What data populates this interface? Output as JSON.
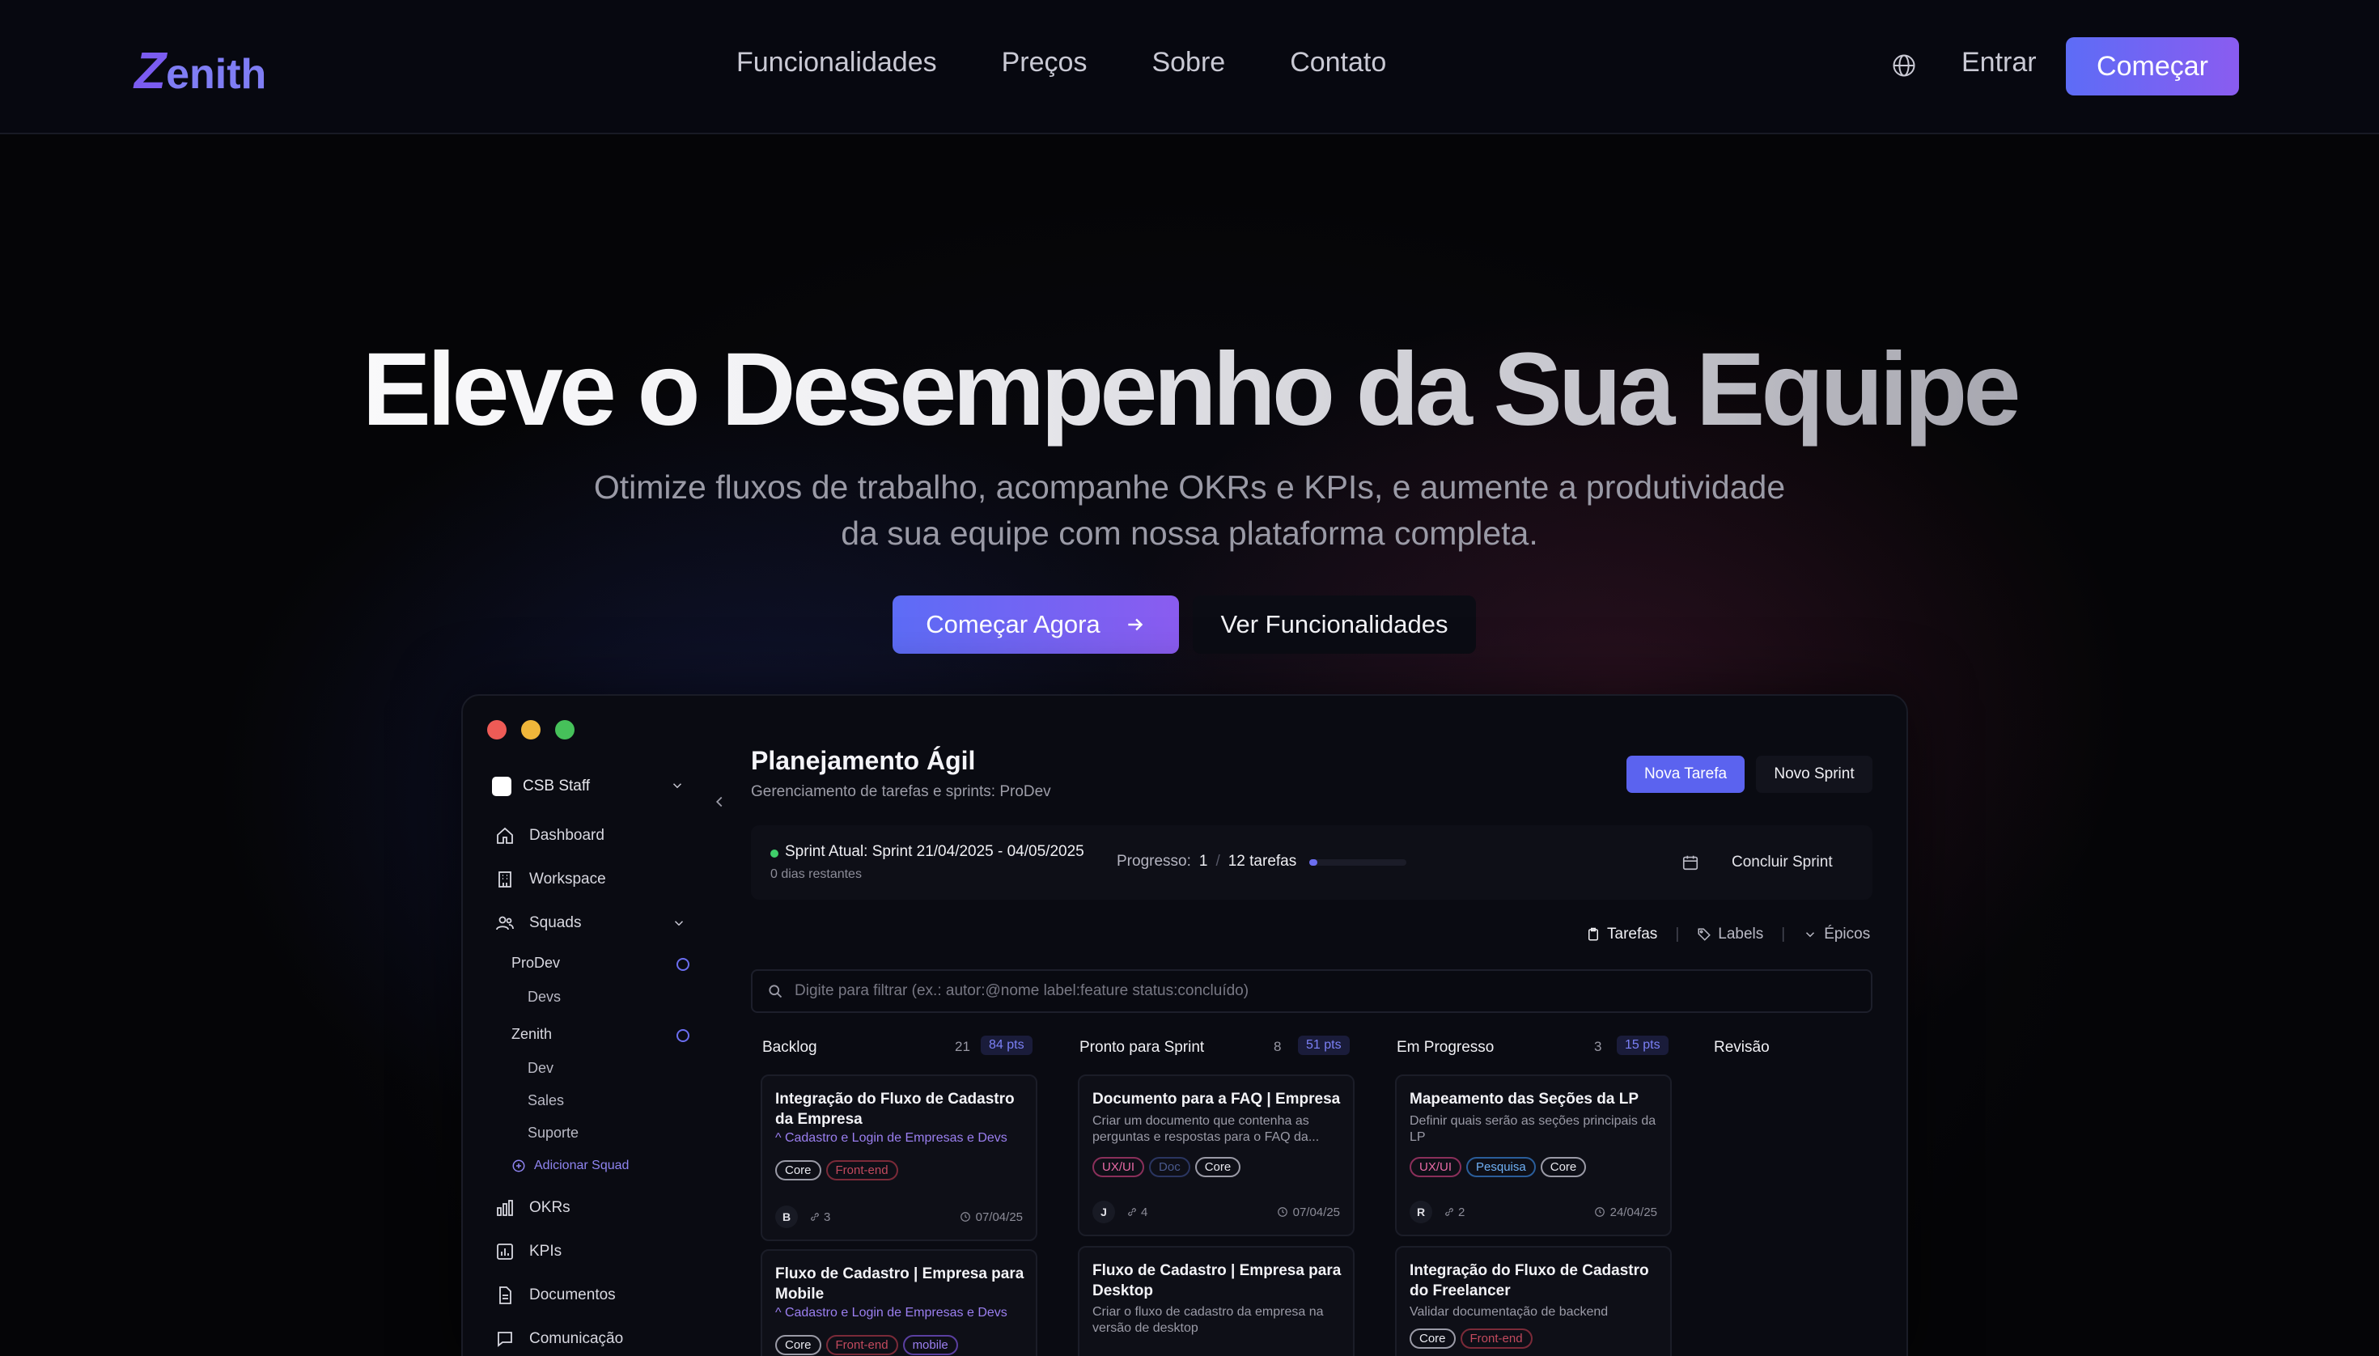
{
  "nav": {
    "logo_z": "Z",
    "logo_rest": "enith",
    "links": [
      "Funcionalidades",
      "Preços",
      "Sobre",
      "Contato"
    ],
    "login": "Entrar",
    "cta": "Começar"
  },
  "hero": {
    "title": "Eleve o Desempenho da Sua Equipe",
    "subtitle": "Otimize fluxos de trabalho, acompanhe OKRs e KPIs, e aumente a produtividade da sua equipe com nossa plataforma completa.",
    "cta_primary": "Começar Agora",
    "cta_secondary": "Ver Funcionalidades"
  },
  "colors": {
    "accent": "#5d6cf6",
    "accent2": "#8a5cf0",
    "bg": "#050507",
    "traffic_red": "#ee5b56",
    "traffic_yellow": "#f0b63a",
    "traffic_green": "#46c15a"
  },
  "app": {
    "org": "CSB Staff",
    "sidebar": {
      "items": [
        "Dashboard",
        "Workspace",
        "Squads"
      ],
      "squads": [
        {
          "name": "ProDev",
          "children": [
            "Devs"
          ]
        },
        {
          "name": "Zenith",
          "children": [
            "Dev",
            "Sales",
            "Suporte"
          ]
        }
      ],
      "add_squad": "Adicionar Squad",
      "bottom_items": [
        "OKRs",
        "KPIs",
        "Documentos",
        "Comunicação"
      ]
    },
    "title": "Planejamento Ágil",
    "subtitle": "Gerenciamento de tarefas e sprints: ProDev",
    "btn_new_task": "Nova Tarefa",
    "btn_new_sprint": "Novo Sprint",
    "sprint": {
      "title": "Sprint Atual: Sprint 21/04/2025 - 04/05/2025",
      "days_left": "0 dias restantes",
      "progress_label": "Progresso:",
      "done": "1",
      "slash": "/",
      "total": "12 tarefas",
      "progress_fraction": 0.08,
      "finish": "Concluir Sprint"
    },
    "filters": [
      "Tarefas",
      "Labels",
      "Épicos"
    ],
    "search_placeholder": "Digite para filtrar (ex.: autor:@nome label:feature status:concluído)",
    "columns": [
      {
        "name": "Backlog",
        "count": "21",
        "points": "84 pts",
        "cards": [
          {
            "title": "Integração do Fluxo de Cadastro da Empresa",
            "epic": "Cadastro e Login de Empresas e Devs",
            "tags": [
              "Core",
              "Front-end"
            ],
            "avatar": "B",
            "links": "3",
            "date": "07/04/25"
          },
          {
            "title": "Fluxo de Cadastro | Empresa para Mobile",
            "epic": "Cadastro e Login de Empresas e Devs",
            "tags": [
              "Core",
              "Front-end",
              "mobile"
            ]
          }
        ]
      },
      {
        "name": "Pronto para Sprint",
        "count": "8",
        "points": "51 pts",
        "cards": [
          {
            "title": "Documento para a FAQ | Empresa",
            "desc": "Criar um documento que contenha as perguntas e respostas para o FAQ da...",
            "tags": [
              "UX/UI",
              "Doc",
              "Core"
            ],
            "avatar": "J",
            "links": "4",
            "date": "07/04/25"
          },
          {
            "title": "Fluxo de Cadastro | Empresa para Desktop",
            "desc": "Criar o fluxo de cadastro da empresa na versão de desktop"
          }
        ]
      },
      {
        "name": "Em Progresso",
        "count": "3",
        "points": "15 pts",
        "cards": [
          {
            "title": "Mapeamento das Seções da LP",
            "desc": "Definir quais serão as seções principais da LP",
            "tags": [
              "UX/UI",
              "Pesquisa",
              "Core"
            ],
            "avatar": "R",
            "links": "2",
            "date": "24/04/25"
          },
          {
            "title": "Integração do Fluxo de Cadastro do Freelancer",
            "desc": "Validar documentação de backend",
            "tags": [
              "Core",
              "Front-end"
            ]
          }
        ]
      },
      {
        "name": "Revisão"
      }
    ]
  }
}
